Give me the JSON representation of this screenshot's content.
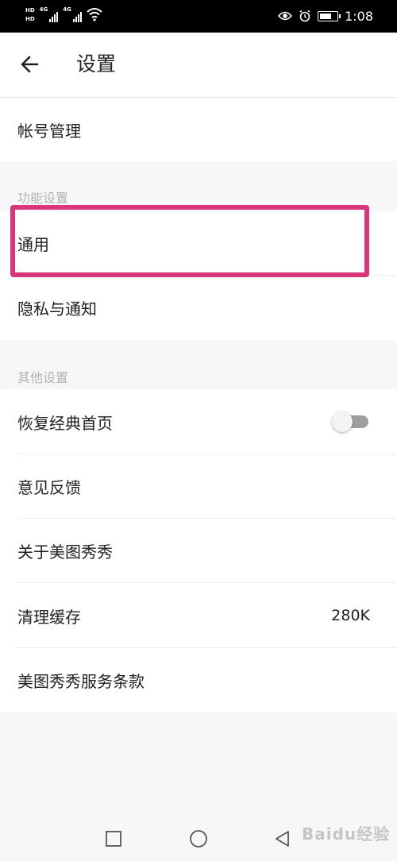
{
  "status_bar": {
    "sim1_top": "HD",
    "sim1_bottom": "HD",
    "signal1_label": "4G",
    "signal2_label": "4G",
    "time": "1:08"
  },
  "header": {
    "title": "设置"
  },
  "account_row": {
    "label": "帐号管理"
  },
  "section_function": {
    "title": "功能设置",
    "items": [
      {
        "label": "通用"
      },
      {
        "label": "隐私与通知"
      }
    ]
  },
  "section_other": {
    "title": "其他设置",
    "items": [
      {
        "label": "恢复经典首页",
        "toggle_on": false
      },
      {
        "label": "意见反馈"
      },
      {
        "label": "关于美图秀秀"
      },
      {
        "label": "清理缓存",
        "value": "280K"
      },
      {
        "label": "美图秀秀服务条款"
      }
    ]
  },
  "highlight_color": "#d8357a",
  "watermark": "Baidu经验"
}
